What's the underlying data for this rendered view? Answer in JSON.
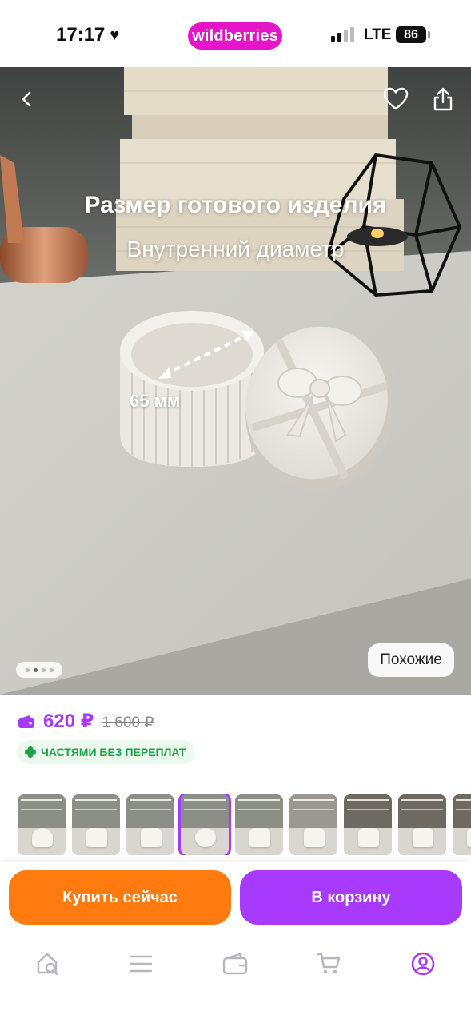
{
  "status_bar": {
    "time": "17:17",
    "brand": "wildberries",
    "network": "LTE",
    "battery": "86",
    "brand_color": "#e514c9"
  },
  "photo": {
    "title": "Размер готового изделия",
    "subtitle": "Внутренний диаметр",
    "dimension_label": "65 мм",
    "similar_label": "Похожие",
    "slide_count": 4,
    "active_slide": 1
  },
  "price": {
    "current": "620 ₽",
    "old": "1 600 ₽",
    "accent_color": "#a73afd",
    "installment_label": "ЧАСТЯМИ БЕЗ ПЕРЕПЛАТ"
  },
  "variants": {
    "count": 10,
    "selected_index": 3
  },
  "actions": {
    "buy_now": "Купить сейчас",
    "add_to_cart": "В корзину",
    "buy_color": "#ff7a0f",
    "cart_color": "#a73afd"
  },
  "bottom_nav": {
    "items": [
      "home-search-icon",
      "catalog-icon",
      "wallet-icon",
      "cart-icon",
      "profile-icon"
    ],
    "active": "profile-icon"
  }
}
